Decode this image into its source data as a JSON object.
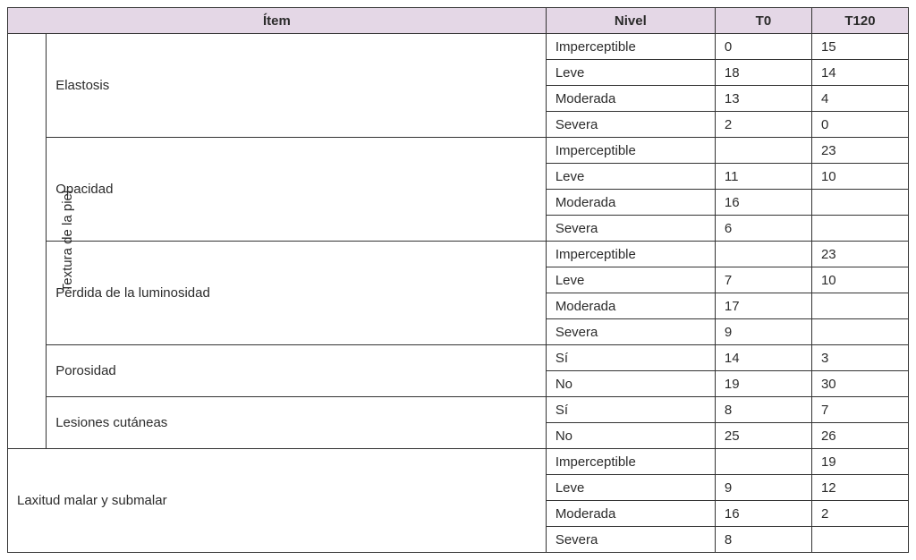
{
  "headers": {
    "item": "Ítem",
    "nivel": "Nivel",
    "t0": "T0",
    "t120": "T120"
  },
  "vcategory": "Textura de la piel",
  "groups": [
    {
      "name": "Elastosis",
      "rows": [
        {
          "nivel": "Imperceptible",
          "t0": "0",
          "t120": "15"
        },
        {
          "nivel": "Leve",
          "t0": "18",
          "t120": "14"
        },
        {
          "nivel": "Moderada",
          "t0": "13",
          "t120": "4"
        },
        {
          "nivel": "Severa",
          "t0": "2",
          "t120": "0"
        }
      ]
    },
    {
      "name": "Opacidad",
      "rows": [
        {
          "nivel": "Imperceptible",
          "t0": "",
          "t120": "23"
        },
        {
          "nivel": "Leve",
          "t0": "11",
          "t120": "10"
        },
        {
          "nivel": "Moderada",
          "t0": "16",
          "t120": ""
        },
        {
          "nivel": "Severa",
          "t0": "6",
          "t120": ""
        }
      ]
    },
    {
      "name": "Pérdida de la luminosidad",
      "rows": [
        {
          "nivel": "Imperceptible",
          "t0": "",
          "t120": "23"
        },
        {
          "nivel": "Leve",
          "t0": "7",
          "t120": "10"
        },
        {
          "nivel": "Moderada",
          "t0": "17",
          "t120": ""
        },
        {
          "nivel": "Severa",
          "t0": "9",
          "t120": ""
        }
      ]
    },
    {
      "name": "Porosidad",
      "rows": [
        {
          "nivel": "Sí",
          "t0": "14",
          "t120": "3"
        },
        {
          "nivel": "No",
          "t0": "19",
          "t120": "30"
        }
      ]
    },
    {
      "name": "Lesiones cutáneas",
      "rows": [
        {
          "nivel": "Sí",
          "t0": "8",
          "t120": "7"
        },
        {
          "nivel": "No",
          "t0": "25",
          "t120": "26"
        }
      ]
    }
  ],
  "bottomGroup": {
    "name": "Laxitud malar y submalar",
    "rows": [
      {
        "nivel": "Imperceptible",
        "t0": "",
        "t120": "19"
      },
      {
        "nivel": "Leve",
        "t0": "9",
        "t120": "12"
      },
      {
        "nivel": "Moderada",
        "t0": "16",
        "t120": "2"
      },
      {
        "nivel": "Severa",
        "t0": "8",
        "t120": ""
      }
    ]
  }
}
